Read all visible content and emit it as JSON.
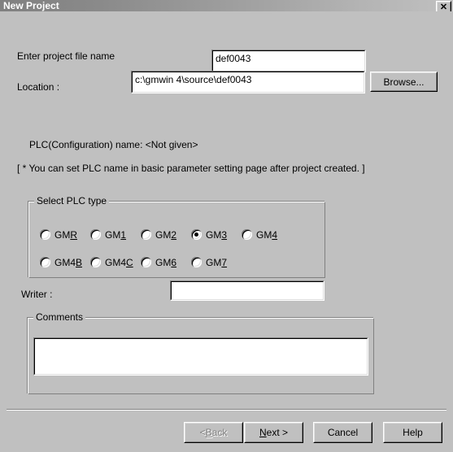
{
  "window": {
    "title": "New Project",
    "close_label": "✕"
  },
  "form": {
    "project_name_label": "Enter project file name",
    "project_name_value": "def0043",
    "location_label": "Location :",
    "location_value": "c:\\gmwin 4\\source\\def0043",
    "browse_label": "Browse...",
    "plc_name_label": "PLC(Configuration) name:   <Not given>",
    "plc_note": "[ * You can set PLC name in basic parameter setting page after project created. ]",
    "writer_label": "Writer :",
    "writer_value": "",
    "comments_legend": "Comments",
    "comments_value": ""
  },
  "plc_type": {
    "legend": "Select PLC type",
    "selected": "GM3",
    "options": [
      {
        "label": "GMR",
        "prefix": "GM",
        "accel": "R",
        "row": 0,
        "col": 0
      },
      {
        "label": "GM1",
        "prefix": "GM",
        "accel": "1",
        "row": 0,
        "col": 1
      },
      {
        "label": "GM2",
        "prefix": "GM",
        "accel": "2",
        "row": 0,
        "col": 2
      },
      {
        "label": "GM3",
        "prefix": "GM",
        "accel": "3",
        "row": 0,
        "col": 3
      },
      {
        "label": "GM4",
        "prefix": "GM",
        "accel": "4",
        "row": 0,
        "col": 4
      },
      {
        "label": "GM4B",
        "prefix": "GM4",
        "accel": "B",
        "row": 1,
        "col": 0
      },
      {
        "label": "GM4C",
        "prefix": "GM4",
        "accel": "C",
        "row": 1,
        "col": 1
      },
      {
        "label": "GM6",
        "prefix": "GM",
        "accel": "6",
        "row": 1,
        "col": 2
      },
      {
        "label": "GM7",
        "prefix": "GM",
        "accel": "7",
        "row": 1,
        "col": 3
      }
    ]
  },
  "footer": {
    "back_prefix": "< ",
    "back_accel": "B",
    "back_suffix": "ack",
    "next_prefix": "",
    "next_accel": "N",
    "next_suffix": "ext >",
    "cancel_label": "Cancel",
    "help_label": "Help",
    "back_disabled": true
  },
  "colors": {
    "face": "#c0c0c0",
    "shadow": "#808080",
    "highlight": "#ffffff",
    "text": "#000000",
    "disabled_text": "#808080",
    "field_bg": "#ffffff",
    "title_start": "#808080",
    "title_end": "#c0c0c0"
  }
}
